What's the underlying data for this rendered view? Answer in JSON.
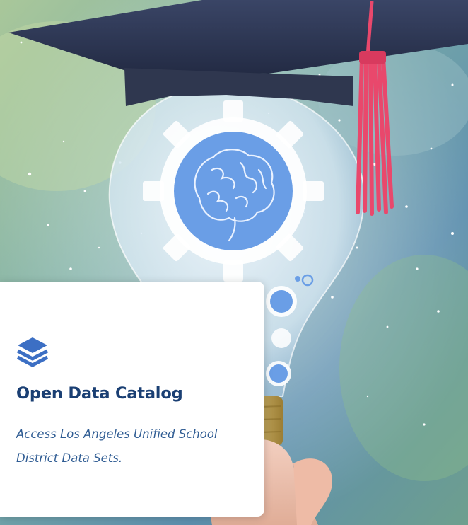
{
  "hero": {
    "illustration": "lightbulb-graduation-cap-brain-gear"
  },
  "card": {
    "icon": "layers-icon",
    "title": "Open Data Catalog",
    "description": "Access Los Angeles Unified School District Data Sets."
  },
  "colors": {
    "title": "#1a3f73",
    "description": "#2f5c93",
    "icon": "#3c6fc4",
    "brain_circle": "#6a9ee6",
    "cap": "#2a3350",
    "tassel": "#e9486c"
  }
}
